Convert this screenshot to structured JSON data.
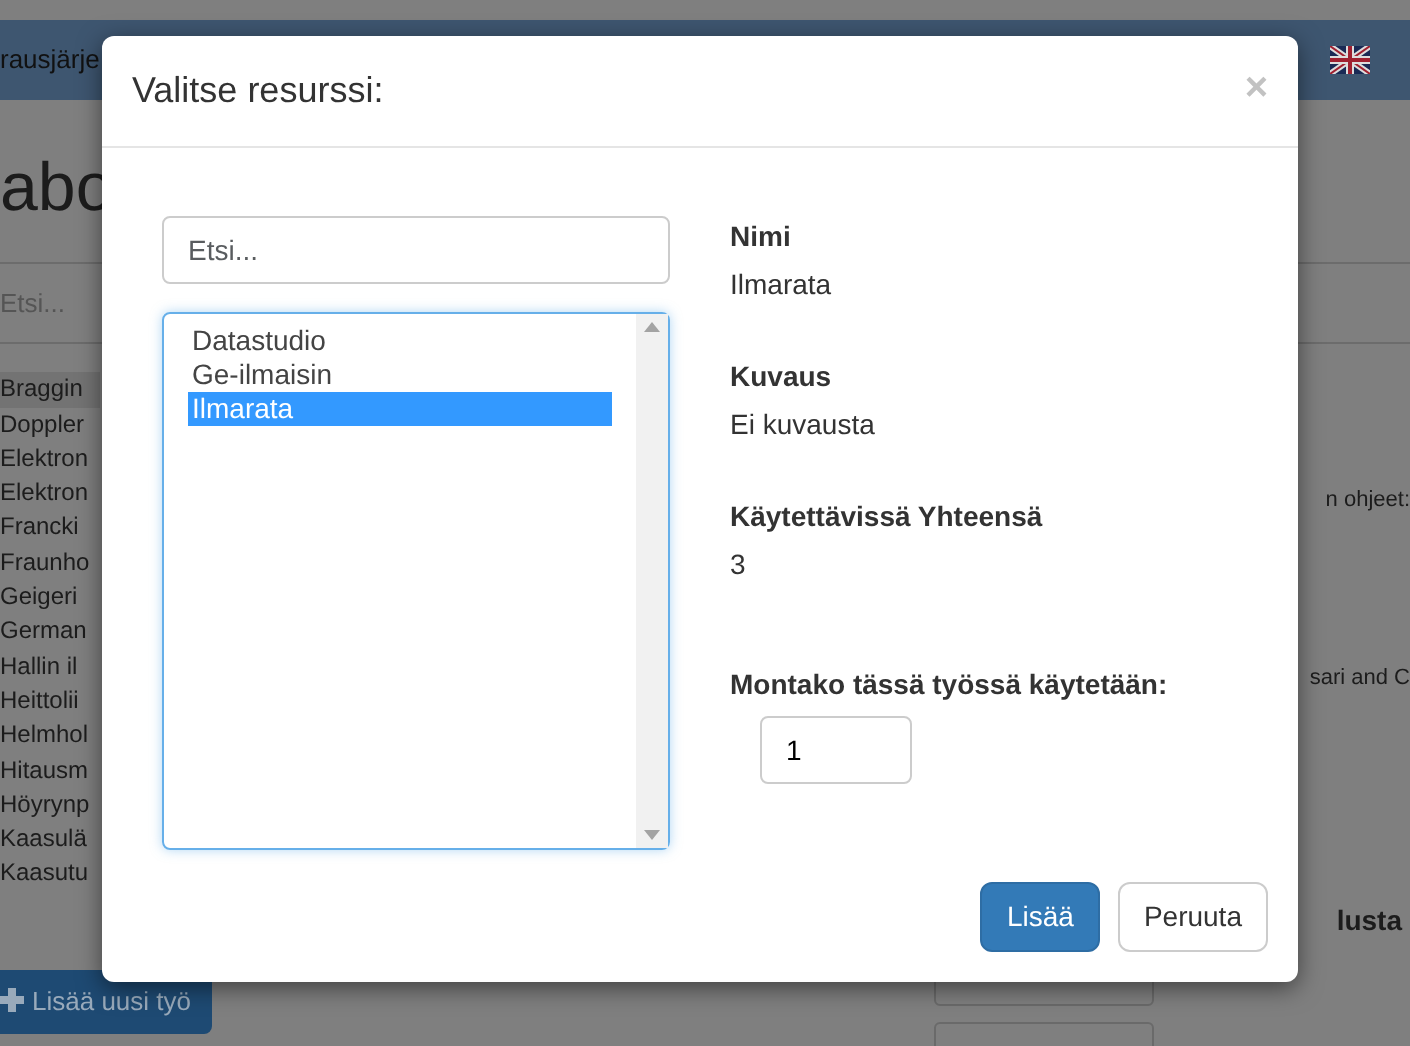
{
  "background": {
    "nav_text": "rausjärje",
    "heading": "abo",
    "search": {
      "placeholder": "Etsi..."
    },
    "list": [
      {
        "label": "Braggin",
        "selected": true
      },
      {
        "label": "Doppler",
        "selected": false
      },
      {
        "label": "Elektron",
        "selected": false
      },
      {
        "label": "Elektron",
        "selected": false
      },
      {
        "label": "Francki",
        "selected": false
      },
      {
        "label": "Fraunho",
        "selected": false
      },
      {
        "label": "Geigeri",
        "selected": false
      },
      {
        "label": "German",
        "selected": false
      },
      {
        "label": "Hallin il",
        "selected": false
      },
      {
        "label": "Heittolii",
        "selected": false
      },
      {
        "label": "Helmhol",
        "selected": false
      },
      {
        "label": "Hitausm",
        "selected": false
      },
      {
        "label": "Höyrynp",
        "selected": false
      },
      {
        "label": "Kaasulä",
        "selected": false
      },
      {
        "label": "Kaasutu",
        "selected": false
      }
    ],
    "right_texts": [
      "n ohjeet:",
      "sari and C",
      "lusta"
    ],
    "add_button": "Lisää uusi työ"
  },
  "modal": {
    "title": "Valitse resurssi:",
    "close": "×",
    "search": {
      "placeholder": "Etsi..."
    },
    "resources": [
      {
        "label": "Datastudio",
        "selected": false
      },
      {
        "label": "Ge-ilmaisin",
        "selected": false
      },
      {
        "label": "Ilmarata",
        "selected": true
      }
    ],
    "details": [
      {
        "label": "Nimi",
        "value": "Ilmarata"
      },
      {
        "label": "Kuvaus",
        "value": "Ei kuvausta"
      },
      {
        "label": "Käytettävissä Yhteensä",
        "value": "3"
      }
    ],
    "quantity": {
      "label": "Montako tässä työssä käytetään:",
      "value": "1"
    },
    "buttons": [
      {
        "label": "Lisää",
        "kind": "primary"
      },
      {
        "label": "Peruuta",
        "kind": "default"
      }
    ]
  }
}
